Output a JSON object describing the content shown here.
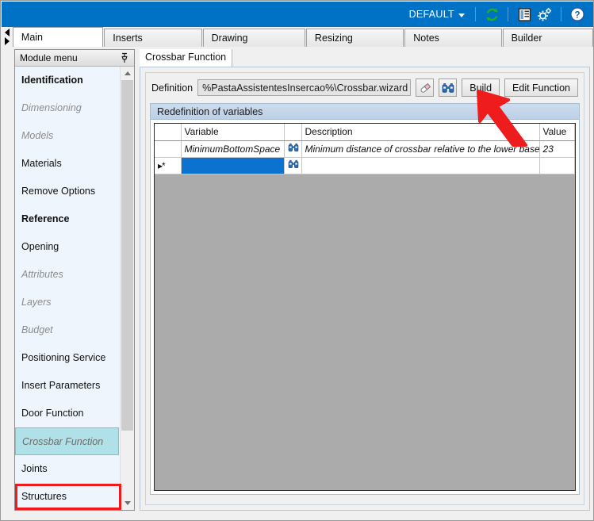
{
  "ribbon": {
    "profile_label": "DEFAULT",
    "icons": [
      {
        "name": "refresh-sync-icon",
        "glyph": "refresh"
      },
      {
        "name": "report-list-icon",
        "glyph": "report"
      },
      {
        "name": "settings-gears-icon",
        "glyph": "gears"
      },
      {
        "name": "help-icon",
        "glyph": "help"
      }
    ]
  },
  "tabs": [
    {
      "label": "Main",
      "active": true
    },
    {
      "label": "Inserts",
      "active": false
    },
    {
      "label": "Drawing",
      "active": false
    },
    {
      "label": "Resizing",
      "active": false
    },
    {
      "label": "Notes",
      "active": false
    },
    {
      "label": "Builder",
      "active": false
    }
  ],
  "sidebar": {
    "title": "Module menu",
    "pin_icon": "pin-icon",
    "items": [
      {
        "label": "Identification",
        "style": "bold"
      },
      {
        "label": "Dimensioning",
        "style": "disabled"
      },
      {
        "label": "Models",
        "style": "disabled"
      },
      {
        "label": "Materials",
        "style": "normal"
      },
      {
        "label": "Remove Options",
        "style": "normal"
      },
      {
        "label": "Reference",
        "style": "bold"
      },
      {
        "label": "Opening",
        "style": "normal"
      },
      {
        "label": "Attributes",
        "style": "disabled"
      },
      {
        "label": "Layers",
        "style": "disabled"
      },
      {
        "label": "Budget",
        "style": "disabled"
      },
      {
        "label": "Positioning Service",
        "style": "normal"
      },
      {
        "label": "Insert Parameters",
        "style": "normal"
      },
      {
        "label": "Door Function",
        "style": "normal"
      },
      {
        "label": "Crossbar Function",
        "style": "selected"
      },
      {
        "label": "Joints",
        "style": "normal"
      },
      {
        "label": "Structures",
        "style": "normal"
      }
    ]
  },
  "content": {
    "tab_label": "Crossbar Function",
    "definition": {
      "label": "Definition",
      "value": "%PastaAssistentesInsercao%\\Crossbar.wizard",
      "placeholder": "",
      "erase_icon": "eraser-icon",
      "browse_icon": "binoculars-icon",
      "build_label": "Build",
      "edit_function_label": "Edit Function"
    },
    "group": {
      "title": "Redefinition of variables",
      "columns": [
        "",
        "Variable",
        "",
        "Description",
        "Value"
      ],
      "rows": [
        {
          "marker": "",
          "variable": "MinimumBottomSpace",
          "find_icon": "binoculars-icon",
          "description": "Minimum distance of crossbar relative to the lower base or left",
          "value": "23",
          "ghost": true,
          "selected": false
        },
        {
          "marker": "▸*",
          "variable": "",
          "find_icon": "binoculars-icon",
          "description": "",
          "value": "",
          "ghost": false,
          "selected": true
        }
      ]
    }
  },
  "annotations": {
    "highlight_rect_name": "crossbar-function-highlight",
    "arrow_name": "build-button-arrow",
    "color": "#ee1c1c"
  },
  "colors": {
    "ribbon_blue": "#0072c6",
    "selection_blue": "#0b72d0",
    "selected_menu": "#b0e0e8",
    "group_header": "#bcd0e6",
    "annotation_red": "#ee1c1c"
  }
}
